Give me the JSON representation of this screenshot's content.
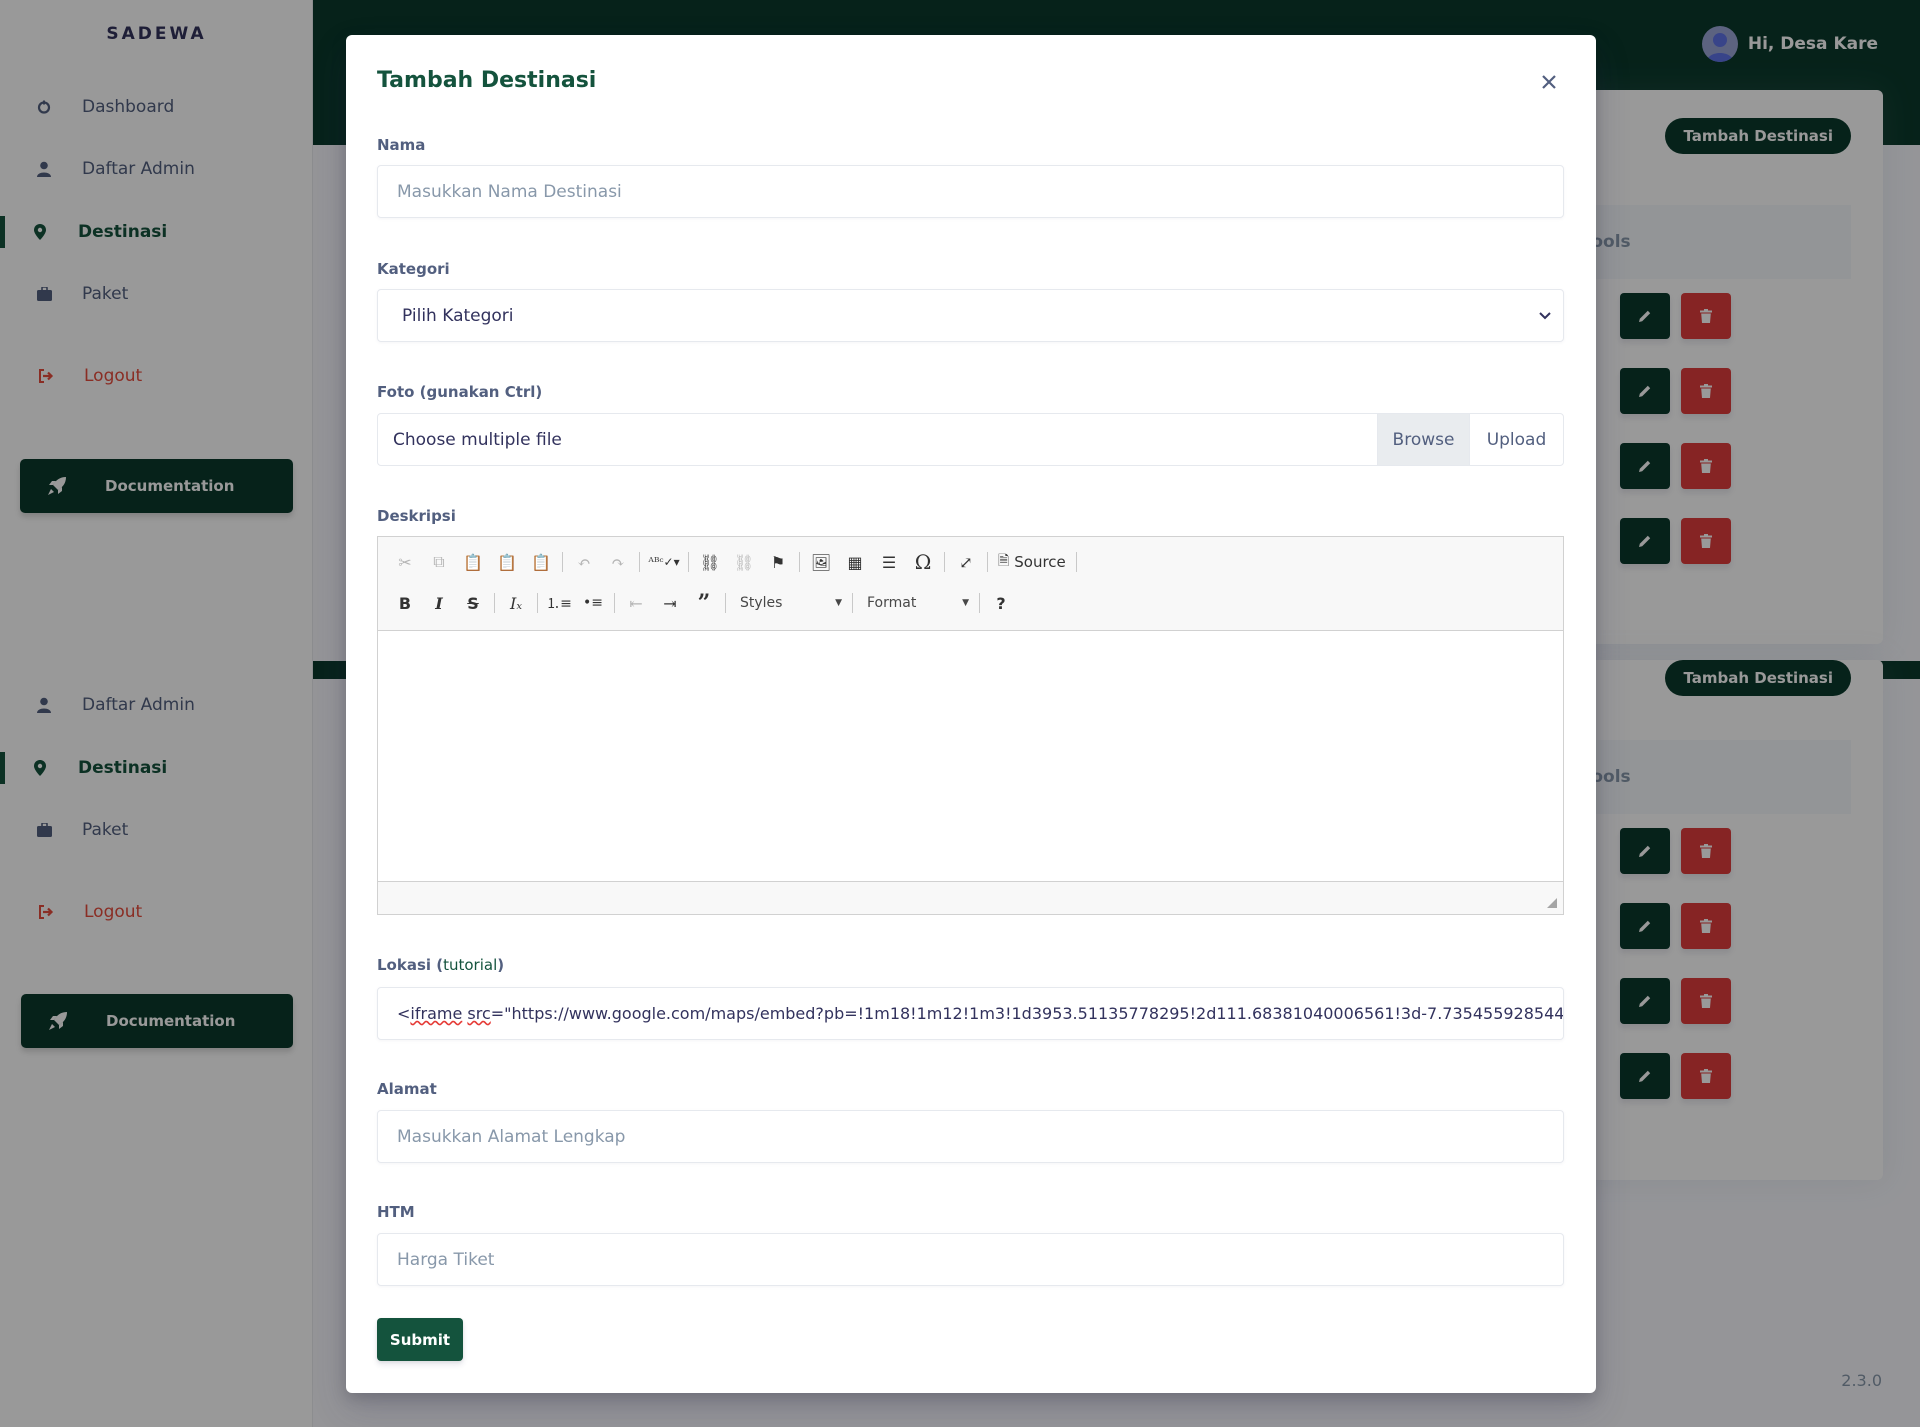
{
  "sidebar": {
    "brand": "SADEWA",
    "items": [
      {
        "label": "Dashboard",
        "icon": "dashboard-icon"
      },
      {
        "label": "Daftar Admin",
        "icon": "user-icon"
      },
      {
        "label": "Destinasi",
        "icon": "map-pin-icon",
        "active": true
      },
      {
        "label": "Paket",
        "icon": "briefcase-icon"
      }
    ],
    "logout_label": "Logout",
    "documentation_label": "Documentation",
    "items_repeat": [
      {
        "label": "Daftar Admin"
      },
      {
        "label": "Destinasi"
      },
      {
        "label": "Paket"
      }
    ]
  },
  "header": {
    "greeting": "Hi, Desa Kare"
  },
  "main": {
    "tambah_button_label": "Tambah Destinasi",
    "tools_header": "Tools",
    "version": "2.3.0"
  },
  "modal": {
    "title": "Tambah Destinasi",
    "nama": {
      "label": "Nama",
      "placeholder": "Masukkan Nama Destinasi"
    },
    "kategori": {
      "label": "Kategori",
      "selected": "Pilih Kategori"
    },
    "foto": {
      "label": "Foto (gunakan Ctrl)",
      "file_text": "Choose multiple file",
      "browse_label": "Browse",
      "upload_label": "Upload"
    },
    "deskripsi": {
      "label": "Deskripsi",
      "toolbar": {
        "source_label": "Source",
        "styles_label": "Styles",
        "format_label": "Format"
      }
    },
    "lokasi": {
      "label": "Lokasi (",
      "link_text": "tutorial",
      "label_end": ")",
      "value_prefix": "<",
      "value_word1": "iframe",
      "value_word2": "src",
      "value_rest": "=\"https://www.google.com/maps/embed?pb=!1m18!1m12!1m3!1d3953.51135778295!2d111.68381040006561!3d-7.735455928544"
    },
    "alamat": {
      "label": "Alamat",
      "placeholder": "Masukkan Alamat Lengkap"
    },
    "htm": {
      "label": "HTM",
      "placeholder": "Harga Tiket"
    },
    "submit_label": "Submit"
  },
  "colors": {
    "primary": "#0b3a2c",
    "accent": "#14533d",
    "danger": "#e03c3c"
  }
}
